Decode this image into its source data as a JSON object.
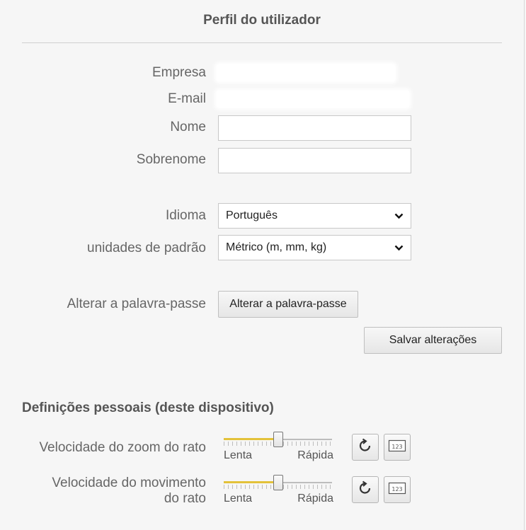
{
  "page": {
    "title": "Perfil do utilizador"
  },
  "profile": {
    "company_label": "Empresa",
    "email_label": "E-mail",
    "first_name_label": "Nome",
    "first_name_value": "",
    "last_name_label": "Sobrenome",
    "last_name_value": "",
    "language_label": "Idioma",
    "language_value": "Português",
    "units_label": "unidades de padrão",
    "units_value": "Métrico (m, mm, kg)",
    "password_label": "Alterar a palavra-passe",
    "password_button": "Alterar a palavra-passe",
    "save_button": "Salvar alterações"
  },
  "personal": {
    "section_title": "Definições pessoais (deste dispositivo)",
    "zoom": {
      "label": "Velocidade do zoom do rato",
      "min_label": "Lenta",
      "max_label": "Rápida",
      "level": 0.5,
      "reset_icon": "reset-icon",
      "numeric_icon": "numeric-input-icon"
    },
    "move": {
      "label_line1": "Velocidade do movimento",
      "label_line2": "do rato",
      "min_label": "Lenta",
      "max_label": "Rápida",
      "level": 0.5,
      "reset_icon": "reset-icon",
      "numeric_icon": "numeric-input-icon"
    }
  },
  "colors": {
    "accent": "#e3c23a",
    "background": "#f6f6f6"
  }
}
